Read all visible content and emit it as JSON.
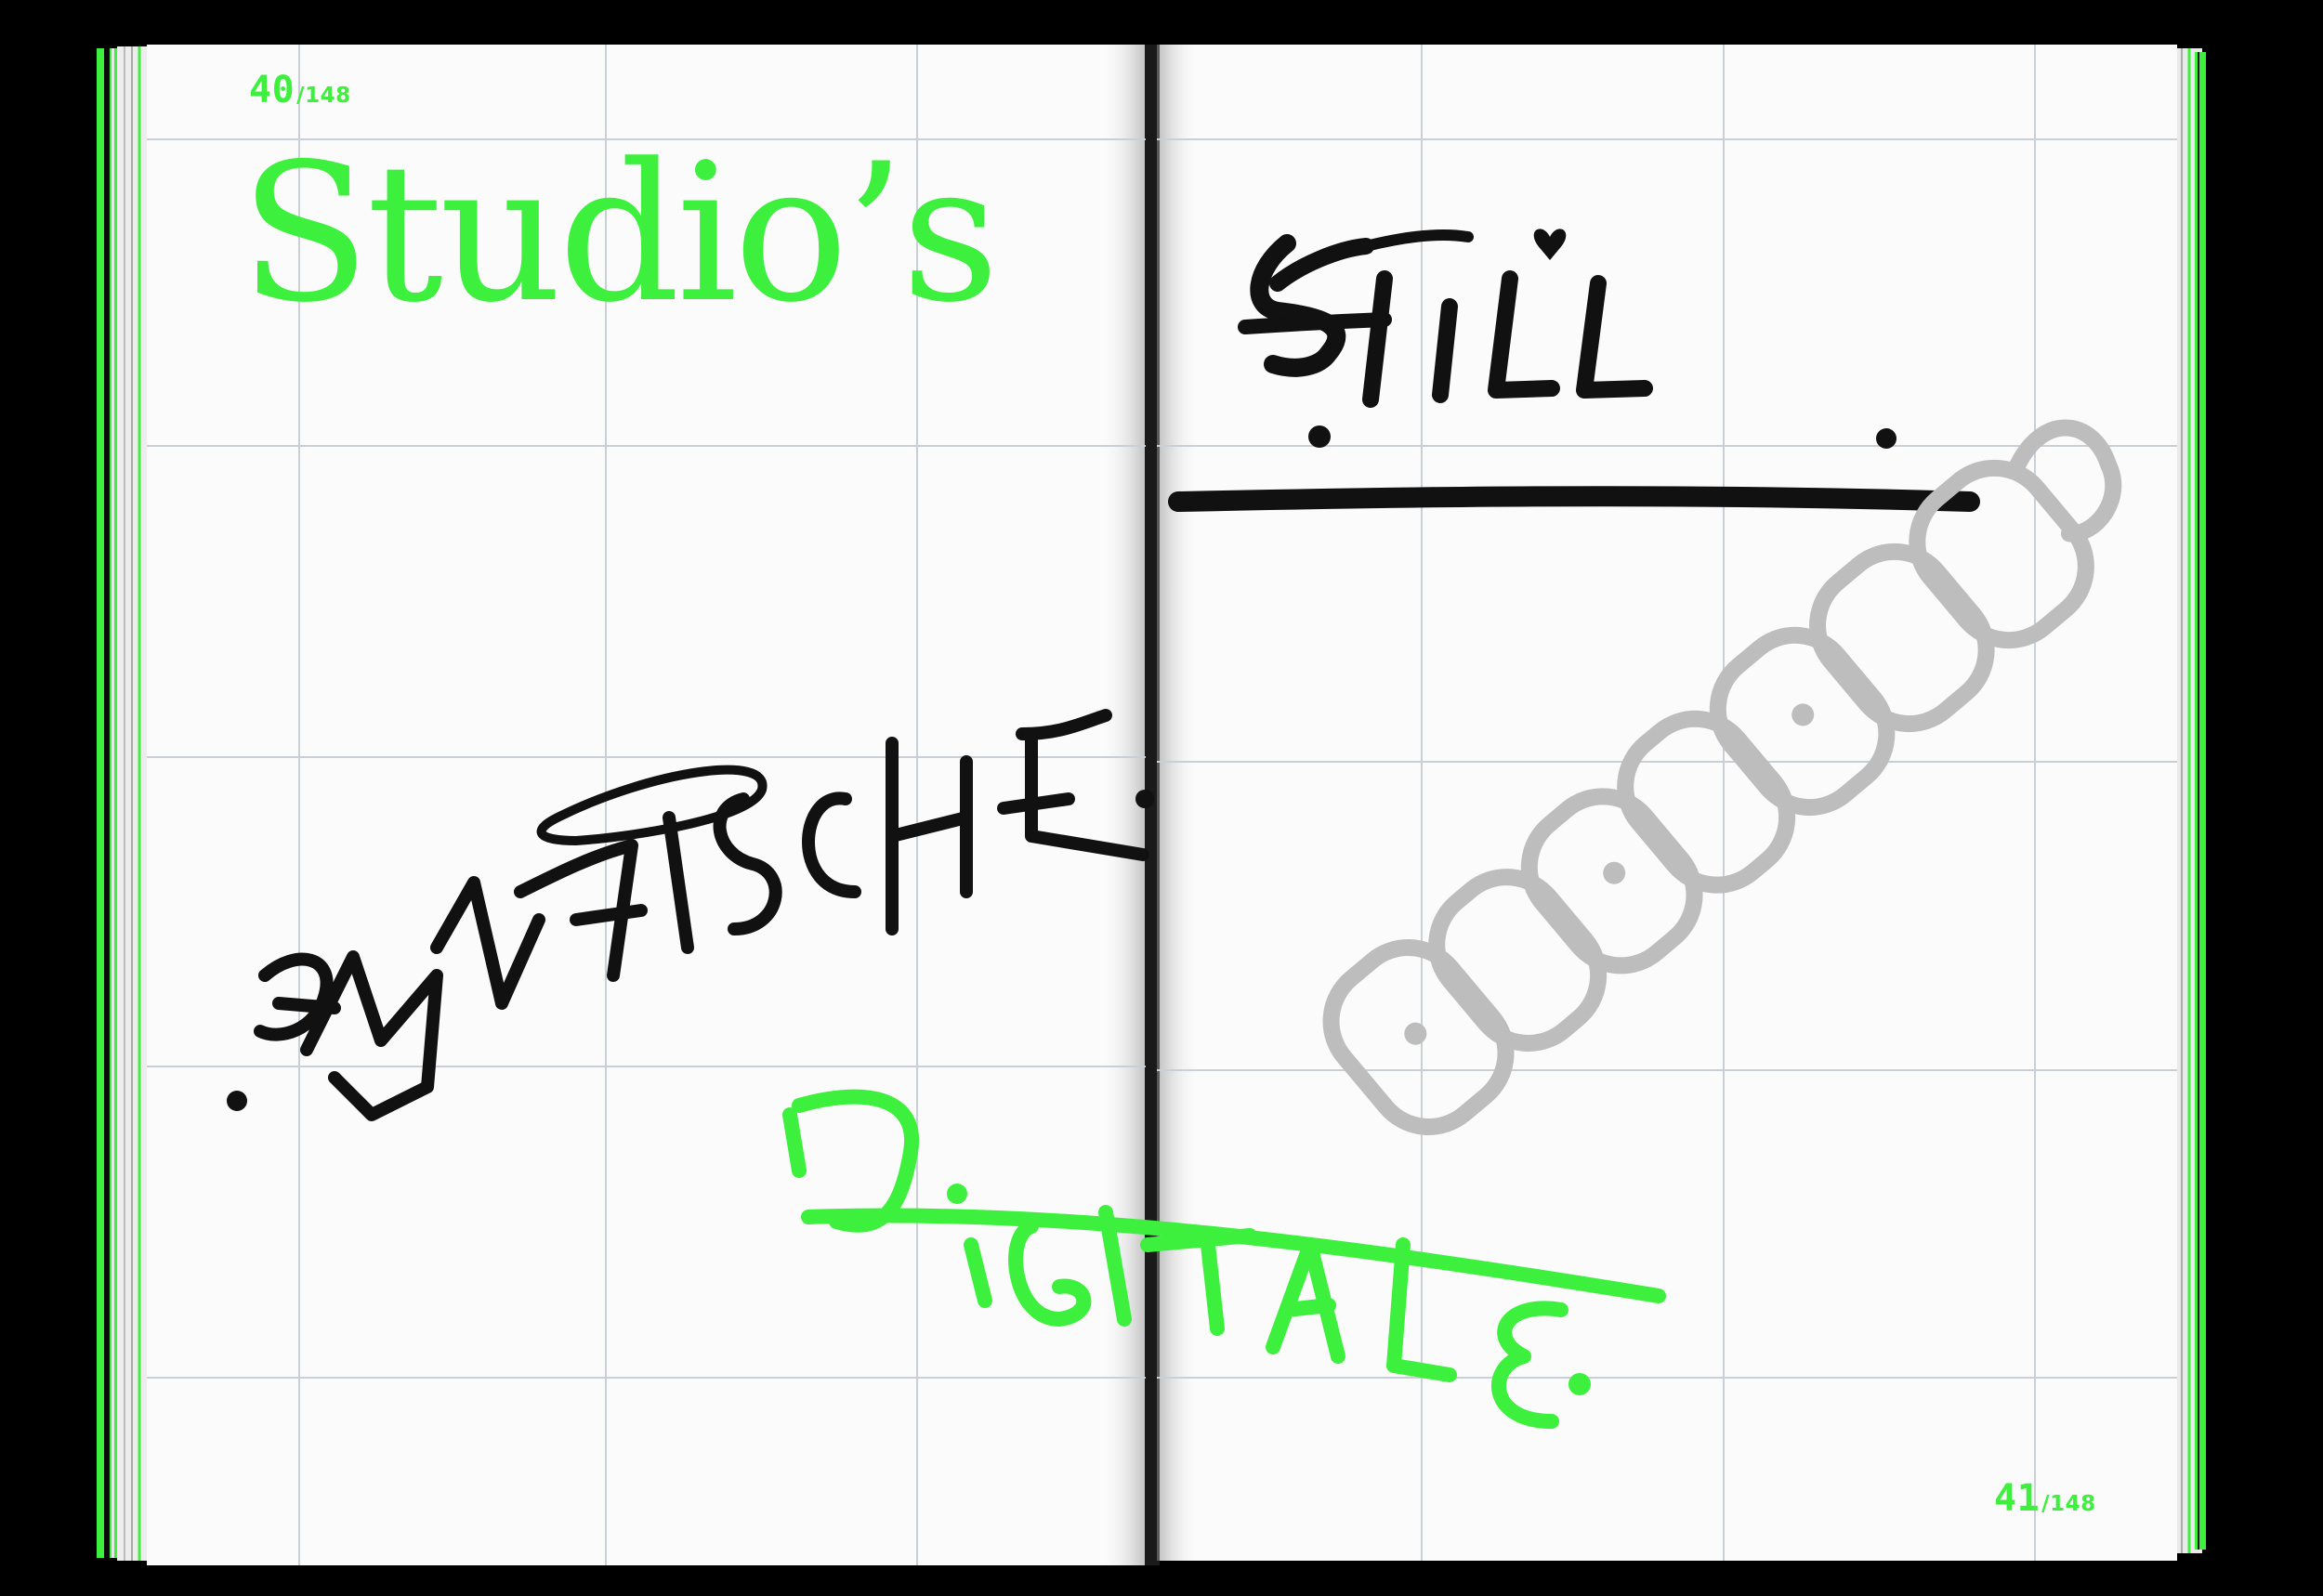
{
  "colors": {
    "background": "#000000",
    "paper": "#fbfbfb",
    "grid": "#c9cfd6",
    "accent_green": "#3df03d",
    "ink_black": "#111111",
    "ink_grey": "#bdbdbd"
  },
  "left_page": {
    "page_number": "40",
    "page_total": "/148",
    "title": "Studio’s",
    "tag_graffiti": "GRAFISCHE."
  },
  "right_page": {
    "page_number": "41",
    "page_total": "/148",
    "tag_still": "STILL.",
    "tag_bubble": "BESCHAMP"
  },
  "crossing_tag": "DIGITALE."
}
